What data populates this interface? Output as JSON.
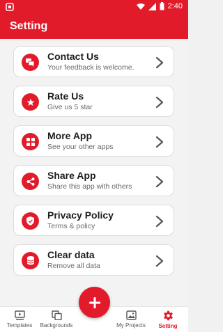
{
  "status_bar": {
    "time": "2:40"
  },
  "app_bar": {
    "title": "Setting"
  },
  "menu": [
    {
      "title": "Contact Us",
      "subtitle": "Your feedback is welcome.",
      "icon": "chat-icon"
    },
    {
      "title": "Rate Us",
      "subtitle": "Give us 5 star",
      "icon": "star-icon"
    },
    {
      "title": "More App",
      "subtitle": "See your other apps",
      "icon": "grid-icon"
    },
    {
      "title": "Share App",
      "subtitle": "Share this app with others",
      "icon": "share-icon"
    },
    {
      "title": "Privacy Policy",
      "subtitle": "Terms & policy",
      "icon": "shield-icon"
    },
    {
      "title": "Clear data",
      "subtitle": "Remove all data",
      "icon": "database-icon"
    }
  ],
  "bottom_nav": {
    "templates": "Templates",
    "backgrounds": "Backgrounds",
    "my_projects": "My Projects",
    "setting": "Setting"
  },
  "colors": {
    "accent": "#e21b2b",
    "background": "#f3f3f3",
    "card": "#ffffff"
  }
}
